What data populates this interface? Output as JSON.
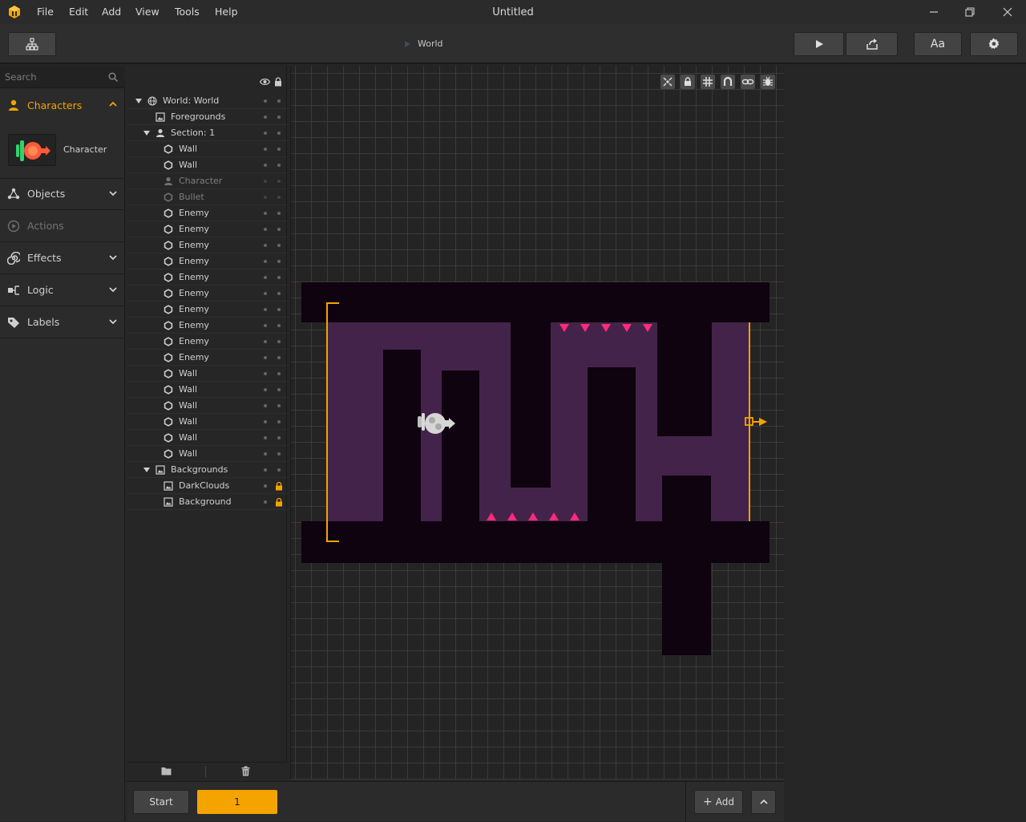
{
  "window": {
    "title": "Untitled",
    "menu": [
      "File",
      "Edit",
      "Add",
      "View",
      "Tools",
      "Help"
    ]
  },
  "toolbar": {
    "breadcrumb": "World",
    "font_button": "Aa"
  },
  "sidebar": {
    "search_placeholder": "Search",
    "categories": [
      {
        "label": "Characters",
        "expanded": true,
        "active": true
      },
      {
        "label": "Objects"
      },
      {
        "label": "Actions",
        "disabled": true
      },
      {
        "label": "Effects"
      },
      {
        "label": "Logic"
      },
      {
        "label": "Labels"
      }
    ],
    "character_item": "Character"
  },
  "hierarchy": {
    "rows": [
      {
        "label": "World: World",
        "icon": "globe-icon",
        "arrow": true,
        "indent": 0
      },
      {
        "label": "Foregrounds",
        "icon": "image-icon",
        "indent": 1
      },
      {
        "label": "Section: 1",
        "icon": "person-icon",
        "arrow": true,
        "indent": 1
      },
      {
        "label": "Wall",
        "icon": "hexagon-icon",
        "indent": 2
      },
      {
        "label": "Wall",
        "icon": "hexagon-icon",
        "indent": 2
      },
      {
        "label": "Character",
        "icon": "person-icon",
        "indent": 2,
        "dim": true
      },
      {
        "label": "Bullet",
        "icon": "hexagon-icon",
        "indent": 2,
        "dim": true
      },
      {
        "label": "Enemy",
        "icon": "hexagon-icon",
        "indent": 2
      },
      {
        "label": "Enemy",
        "icon": "hexagon-icon",
        "indent": 2
      },
      {
        "label": "Enemy",
        "icon": "hexagon-icon",
        "indent": 2
      },
      {
        "label": "Enemy",
        "icon": "hexagon-icon",
        "indent": 2
      },
      {
        "label": "Enemy",
        "icon": "hexagon-icon",
        "indent": 2
      },
      {
        "label": "Enemy",
        "icon": "hexagon-icon",
        "indent": 2
      },
      {
        "label": "Enemy",
        "icon": "hexagon-icon",
        "indent": 2
      },
      {
        "label": "Enemy",
        "icon": "hexagon-icon",
        "indent": 2
      },
      {
        "label": "Enemy",
        "icon": "hexagon-icon",
        "indent": 2
      },
      {
        "label": "Enemy",
        "icon": "hexagon-icon",
        "indent": 2
      },
      {
        "label": "Wall",
        "icon": "hexagon-icon",
        "indent": 2
      },
      {
        "label": "Wall",
        "icon": "hexagon-icon",
        "indent": 2
      },
      {
        "label": "Wall",
        "icon": "hexagon-icon",
        "indent": 2
      },
      {
        "label": "Wall",
        "icon": "hexagon-icon",
        "indent": 2
      },
      {
        "label": "Wall",
        "icon": "hexagon-icon",
        "indent": 2
      },
      {
        "label": "Wall",
        "icon": "hexagon-icon",
        "indent": 2
      },
      {
        "label": "Backgrounds",
        "icon": "image-icon",
        "arrow": true,
        "indent": 1
      },
      {
        "label": "DarkClouds",
        "icon": "image-icon",
        "indent": 2,
        "locked": true
      },
      {
        "label": "Background",
        "icon": "image-icon",
        "indent": 2,
        "locked": true
      }
    ]
  },
  "bottom": {
    "start_label": "Start",
    "section_label": "1",
    "add_label": "Add"
  },
  "colors": {
    "accent": "#f5a300",
    "level_purple": "#44234a",
    "level_dark": "#0e030e",
    "spike": "#ff2a7a"
  }
}
